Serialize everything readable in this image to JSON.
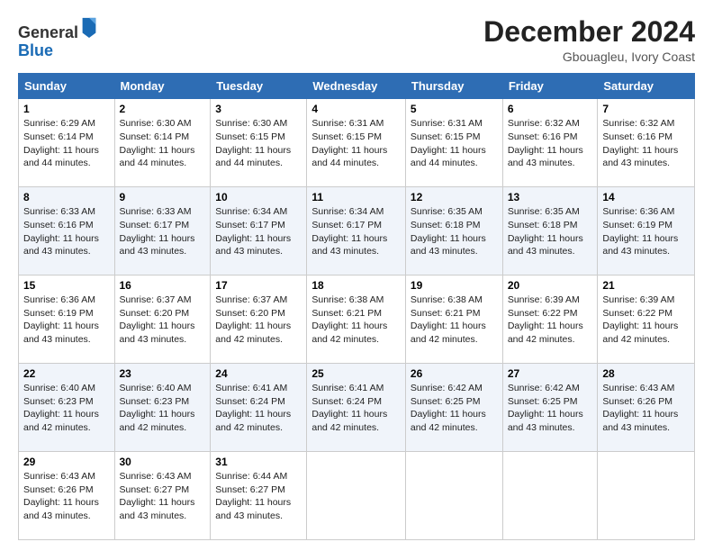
{
  "logo": {
    "general": "General",
    "blue": "Blue"
  },
  "header": {
    "month": "December 2024",
    "location": "Gbouagleu, Ivory Coast"
  },
  "weekdays": [
    "Sunday",
    "Monday",
    "Tuesday",
    "Wednesday",
    "Thursday",
    "Friday",
    "Saturday"
  ],
  "weeks": [
    [
      {
        "day": "1",
        "sunrise": "6:29 AM",
        "sunset": "6:14 PM",
        "daylight": "11 hours and 44 minutes."
      },
      {
        "day": "2",
        "sunrise": "6:30 AM",
        "sunset": "6:14 PM",
        "daylight": "11 hours and 44 minutes."
      },
      {
        "day": "3",
        "sunrise": "6:30 AM",
        "sunset": "6:15 PM",
        "daylight": "11 hours and 44 minutes."
      },
      {
        "day": "4",
        "sunrise": "6:31 AM",
        "sunset": "6:15 PM",
        "daylight": "11 hours and 44 minutes."
      },
      {
        "day": "5",
        "sunrise": "6:31 AM",
        "sunset": "6:15 PM",
        "daylight": "11 hours and 44 minutes."
      },
      {
        "day": "6",
        "sunrise": "6:32 AM",
        "sunset": "6:16 PM",
        "daylight": "11 hours and 43 minutes."
      },
      {
        "day": "7",
        "sunrise": "6:32 AM",
        "sunset": "6:16 PM",
        "daylight": "11 hours and 43 minutes."
      }
    ],
    [
      {
        "day": "8",
        "sunrise": "6:33 AM",
        "sunset": "6:16 PM",
        "daylight": "11 hours and 43 minutes."
      },
      {
        "day": "9",
        "sunrise": "6:33 AM",
        "sunset": "6:17 PM",
        "daylight": "11 hours and 43 minutes."
      },
      {
        "day": "10",
        "sunrise": "6:34 AM",
        "sunset": "6:17 PM",
        "daylight": "11 hours and 43 minutes."
      },
      {
        "day": "11",
        "sunrise": "6:34 AM",
        "sunset": "6:17 PM",
        "daylight": "11 hours and 43 minutes."
      },
      {
        "day": "12",
        "sunrise": "6:35 AM",
        "sunset": "6:18 PM",
        "daylight": "11 hours and 43 minutes."
      },
      {
        "day": "13",
        "sunrise": "6:35 AM",
        "sunset": "6:18 PM",
        "daylight": "11 hours and 43 minutes."
      },
      {
        "day": "14",
        "sunrise": "6:36 AM",
        "sunset": "6:19 PM",
        "daylight": "11 hours and 43 minutes."
      }
    ],
    [
      {
        "day": "15",
        "sunrise": "6:36 AM",
        "sunset": "6:19 PM",
        "daylight": "11 hours and 43 minutes."
      },
      {
        "day": "16",
        "sunrise": "6:37 AM",
        "sunset": "6:20 PM",
        "daylight": "11 hours and 43 minutes."
      },
      {
        "day": "17",
        "sunrise": "6:37 AM",
        "sunset": "6:20 PM",
        "daylight": "11 hours and 42 minutes."
      },
      {
        "day": "18",
        "sunrise": "6:38 AM",
        "sunset": "6:21 PM",
        "daylight": "11 hours and 42 minutes."
      },
      {
        "day": "19",
        "sunrise": "6:38 AM",
        "sunset": "6:21 PM",
        "daylight": "11 hours and 42 minutes."
      },
      {
        "day": "20",
        "sunrise": "6:39 AM",
        "sunset": "6:22 PM",
        "daylight": "11 hours and 42 minutes."
      },
      {
        "day": "21",
        "sunrise": "6:39 AM",
        "sunset": "6:22 PM",
        "daylight": "11 hours and 42 minutes."
      }
    ],
    [
      {
        "day": "22",
        "sunrise": "6:40 AM",
        "sunset": "6:23 PM",
        "daylight": "11 hours and 42 minutes."
      },
      {
        "day": "23",
        "sunrise": "6:40 AM",
        "sunset": "6:23 PM",
        "daylight": "11 hours and 42 minutes."
      },
      {
        "day": "24",
        "sunrise": "6:41 AM",
        "sunset": "6:24 PM",
        "daylight": "11 hours and 42 minutes."
      },
      {
        "day": "25",
        "sunrise": "6:41 AM",
        "sunset": "6:24 PM",
        "daylight": "11 hours and 42 minutes."
      },
      {
        "day": "26",
        "sunrise": "6:42 AM",
        "sunset": "6:25 PM",
        "daylight": "11 hours and 42 minutes."
      },
      {
        "day": "27",
        "sunrise": "6:42 AM",
        "sunset": "6:25 PM",
        "daylight": "11 hours and 43 minutes."
      },
      {
        "day": "28",
        "sunrise": "6:43 AM",
        "sunset": "6:26 PM",
        "daylight": "11 hours and 43 minutes."
      }
    ],
    [
      {
        "day": "29",
        "sunrise": "6:43 AM",
        "sunset": "6:26 PM",
        "daylight": "11 hours and 43 minutes."
      },
      {
        "day": "30",
        "sunrise": "6:43 AM",
        "sunset": "6:27 PM",
        "daylight": "11 hours and 43 minutes."
      },
      {
        "day": "31",
        "sunrise": "6:44 AM",
        "sunset": "6:27 PM",
        "daylight": "11 hours and 43 minutes."
      },
      null,
      null,
      null,
      null
    ]
  ]
}
